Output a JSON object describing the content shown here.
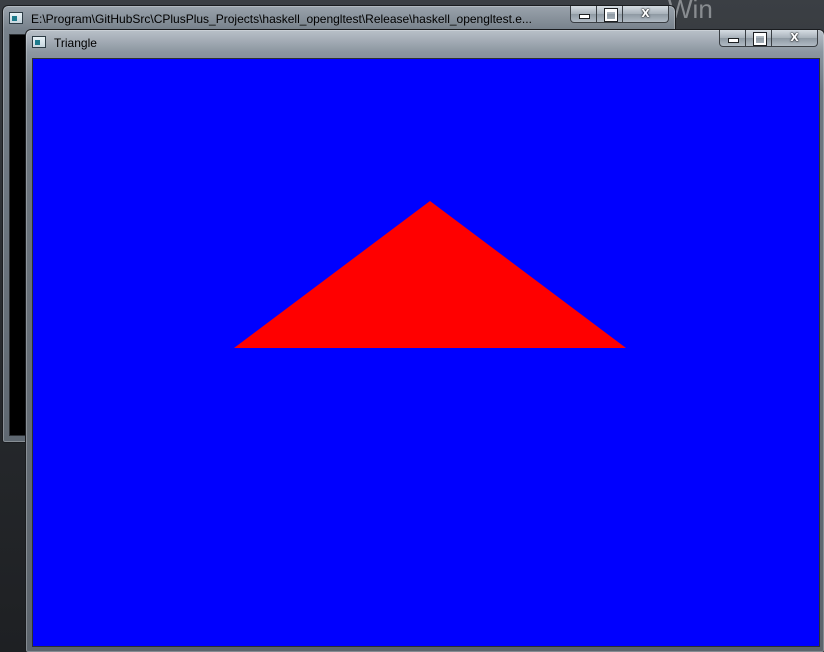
{
  "background_window": {
    "title": "E:\\Program\\GitHubSrc\\CPlusPlus_Projects\\haskell_opengltest\\Release\\haskell_opengltest.e..."
  },
  "background_desktop": {
    "partial_text": "Win",
    "partial_subtext": "..."
  },
  "main_window": {
    "title": "Triangle"
  },
  "caption": {
    "close_glyph": "X"
  },
  "scene": {
    "background_color": "#0000ff",
    "shape_color": "#ff0000"
  }
}
